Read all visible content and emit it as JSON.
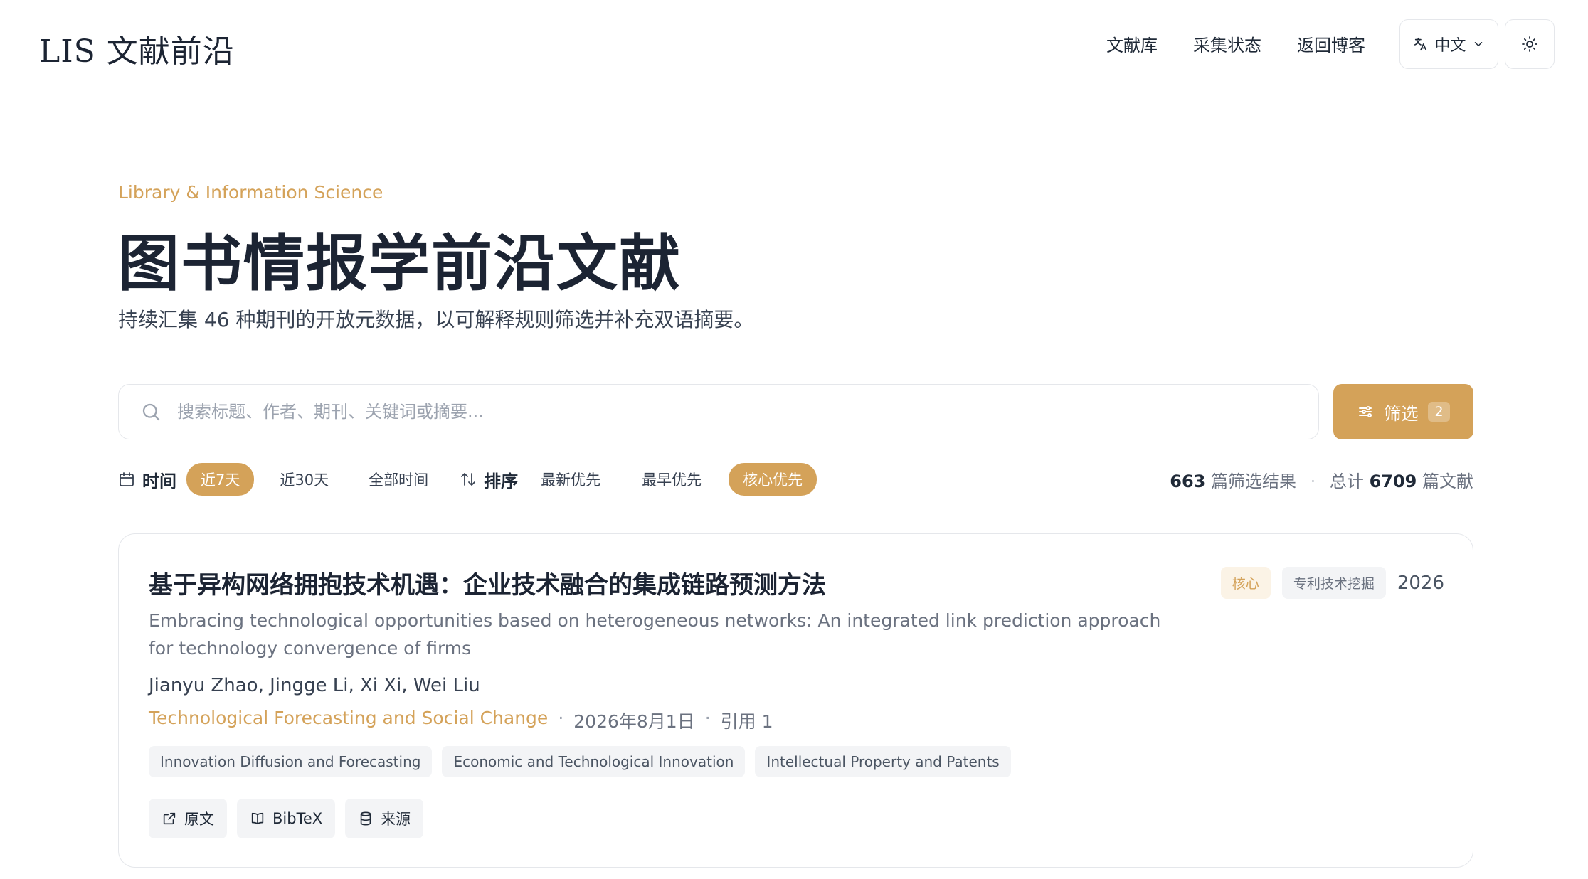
{
  "header": {
    "logo": "LIS 文献前沿",
    "nav": [
      "文献库",
      "采集状态",
      "返回博客"
    ],
    "language": "中文"
  },
  "hero": {
    "eyebrow": "Library & Information Science",
    "title": "图书情报学前沿文献",
    "subtitle": "持续汇集 46 种期刊的开放元数据，以可解释规则筛选并补充双语摘要。"
  },
  "search": {
    "placeholder": "搜索标题、作者、期刊、关键词或摘要...",
    "value": ""
  },
  "filter_button": {
    "label": "筛选",
    "count": "2"
  },
  "toolbar": {
    "time_label": "时间",
    "time_options": [
      {
        "label": "近7天",
        "active": true
      },
      {
        "label": "近30天",
        "active": false
      },
      {
        "label": "全部时间",
        "active": false
      }
    ],
    "sort_label": "排序",
    "sort_options": [
      {
        "label": "最新优先",
        "active": false
      },
      {
        "label": "最早优先",
        "active": false
      },
      {
        "label": "核心优先",
        "active": true
      }
    ],
    "stats": {
      "filtered_count": "663",
      "filtered_suffix": "篇筛选结果",
      "total_prefix": "总计",
      "total_count": "6709",
      "total_suffix": "篇文献"
    }
  },
  "article": {
    "title_zh": "基于异构网络拥抱技术机遇：企业技术融合的集成链路预测方法",
    "title_en": "Embracing technological opportunities based on heterogeneous networks: An integrated link prediction approach for technology convergence of firms",
    "badge_core": "核心",
    "badge_topic": "专利技术挖掘",
    "year": "2026",
    "authors": "Jianyu Zhao, Jingge Li, Xi Xi, Wei Liu",
    "journal": "Technological Forecasting and Social Change",
    "date": "2026年8月1日",
    "citations": "引用 1",
    "tags": [
      "Innovation Diffusion and Forecasting",
      "Economic and Technological Innovation",
      "Intellectual Property and Patents"
    ],
    "actions": [
      {
        "label": "原文",
        "icon": "external-link-icon"
      },
      {
        "label": "BibTeX",
        "icon": "book-icon"
      },
      {
        "label": "来源",
        "icon": "database-icon"
      }
    ]
  },
  "colors": {
    "accent": "#d4a259",
    "text_dark": "#1c2433",
    "muted": "#6b7280",
    "border": "#e5e7eb"
  }
}
